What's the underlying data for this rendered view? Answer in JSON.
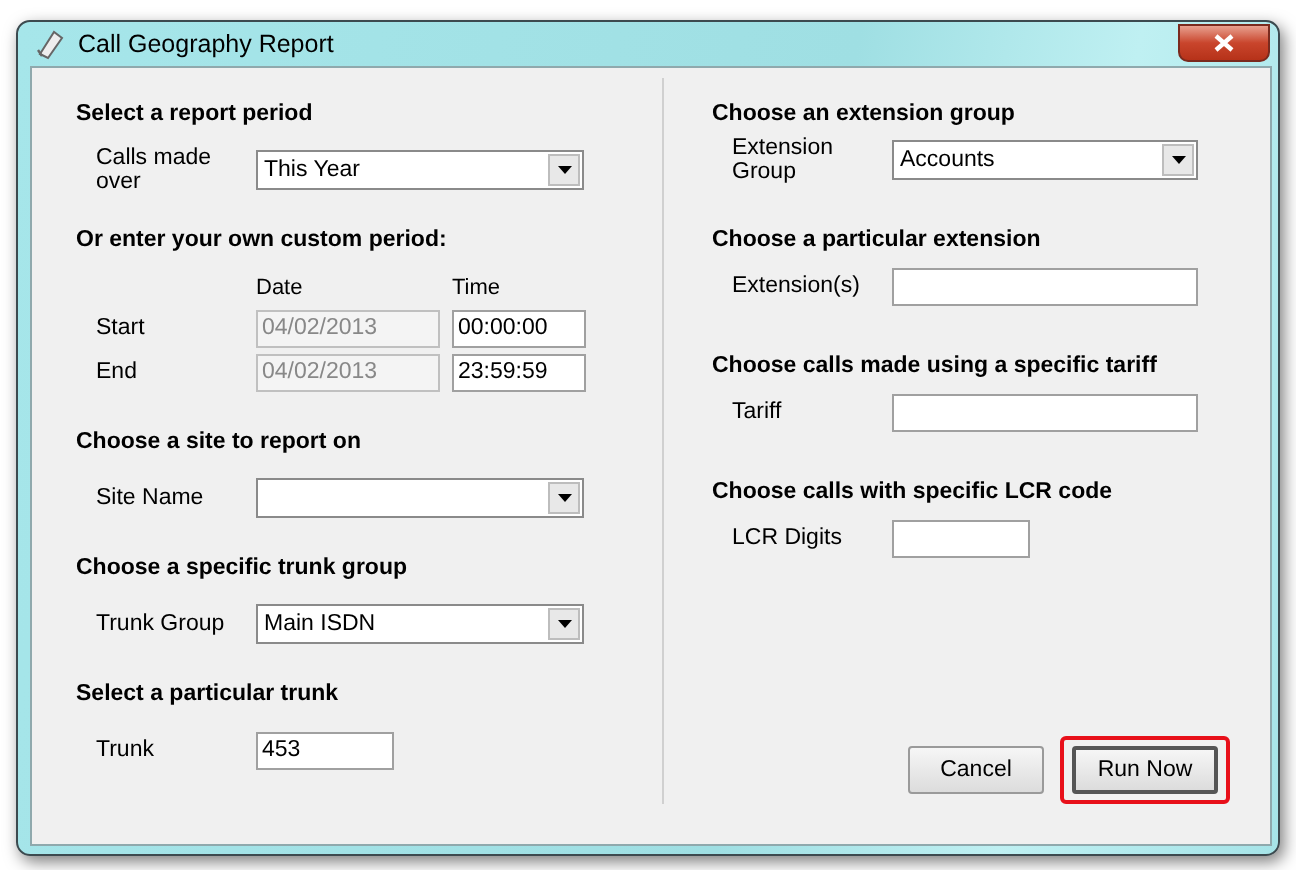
{
  "window": {
    "title": "Call Geography Report"
  },
  "left_sections": [
    {
      "kind": "fields",
      "heading": "Select a report period",
      "rows": [
        {
          "kind": "dropdown",
          "label": "Calls made over",
          "value": "This Year"
        }
      ]
    },
    {
      "kind": "period",
      "heading": "Or enter your own custom period:",
      "columns": [
        "Date",
        "Time"
      ],
      "rows": [
        {
          "label": "Start",
          "date": {
            "value": "04/02/2013",
            "disabled": true
          },
          "time": {
            "value": "00:00:00",
            "disabled": false
          }
        },
        {
          "label": "End",
          "date": {
            "value": "04/02/2013",
            "disabled": true
          },
          "time": {
            "value": "23:59:59",
            "disabled": false
          }
        }
      ]
    },
    {
      "kind": "fields",
      "heading": "Choose a site to report on",
      "rows": [
        {
          "kind": "dropdown",
          "label": "Site Name"
        }
      ]
    },
    {
      "kind": "fields",
      "heading": "Choose a specific trunk group",
      "rows": [
        {
          "kind": "dropdown",
          "label": "Trunk Group",
          "value": "Main ISDN"
        }
      ]
    },
    {
      "kind": "fields",
      "heading": "Select a particular trunk",
      "rows": [
        {
          "kind": "short_text",
          "label": "Trunk",
          "value": "453"
        }
      ]
    }
  ],
  "right_sections": [
    {
      "kind": "fields",
      "heading": "Choose an extension group",
      "rows": [
        {
          "kind": "dropdown",
          "label": "Extension Group",
          "value": "Accounts"
        }
      ]
    },
    {
      "kind": "fields",
      "heading": "Choose a particular extension",
      "rows": [
        {
          "kind": "text",
          "label": "Extension(s)"
        }
      ]
    },
    {
      "kind": "fields",
      "heading": "Choose calls made using a specific tariff",
      "rows": [
        {
          "kind": "text",
          "label": "Tariff"
        }
      ]
    },
    {
      "kind": "fields",
      "heading": "Choose calls with specific LCR code",
      "rows": [
        {
          "kind": "short_text",
          "label": "LCR Digits"
        }
      ]
    }
  ],
  "buttons": [
    {
      "label": "Cancel",
      "default": false,
      "highlighted": false
    },
    {
      "label": "Run Now",
      "default": true,
      "highlighted": true
    }
  ]
}
